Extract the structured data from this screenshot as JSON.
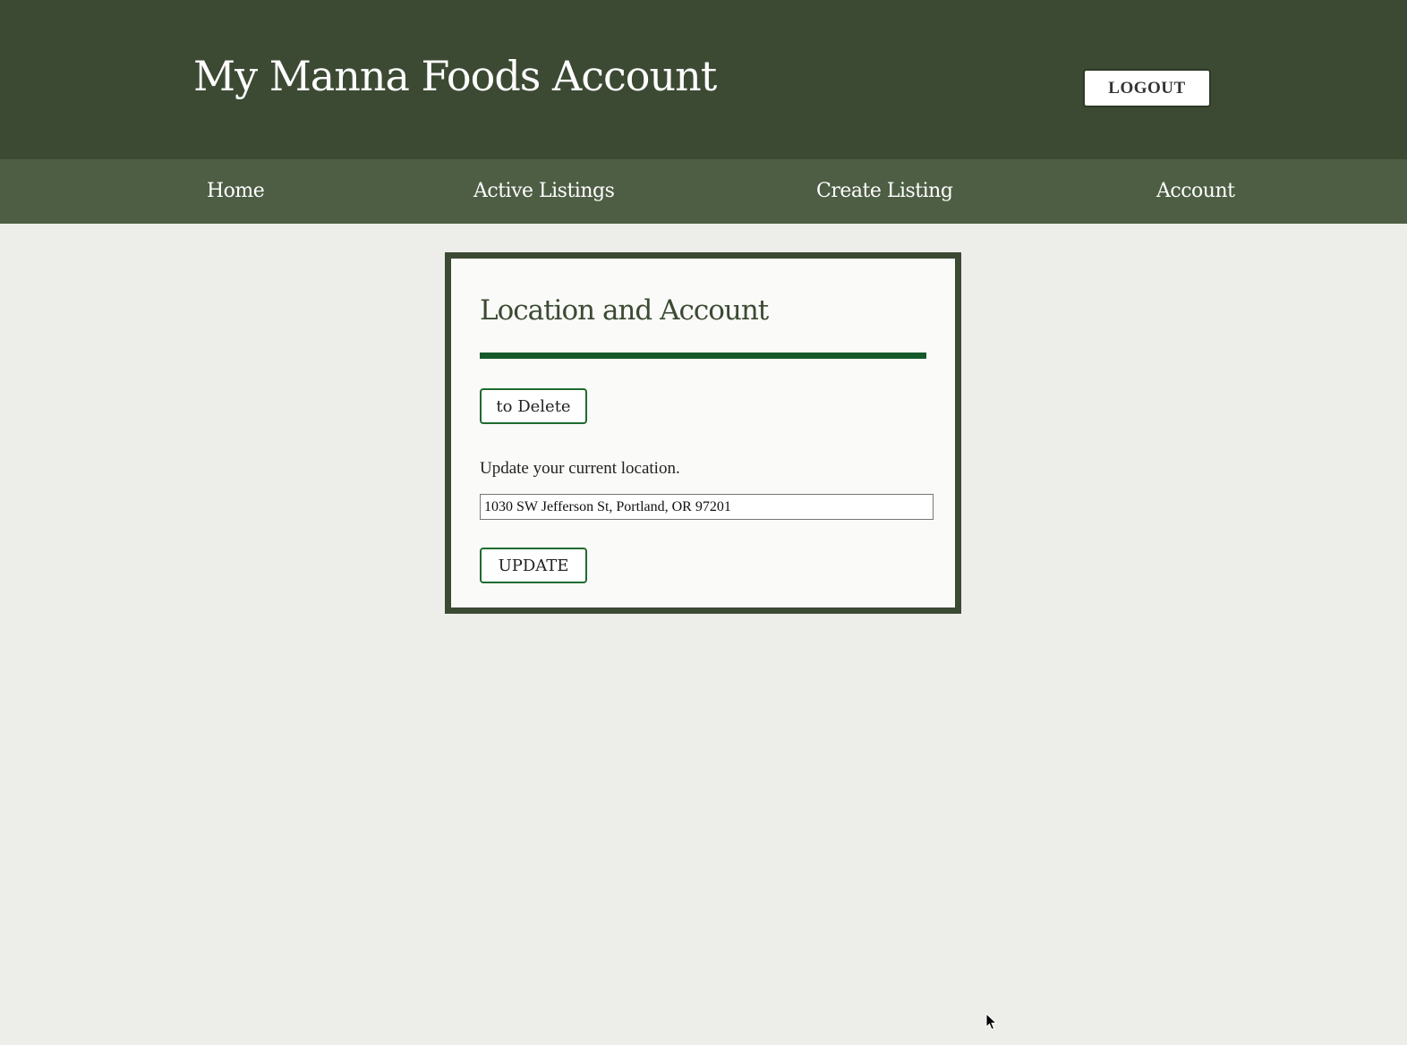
{
  "header": {
    "title": "My Manna Foods Account",
    "logout_label": "LOGOUT"
  },
  "nav": {
    "items": [
      {
        "label": "Home"
      },
      {
        "label": "Active Listings"
      },
      {
        "label": "Create Listing"
      },
      {
        "label": "Account"
      }
    ]
  },
  "account_card": {
    "title": "Location and Account",
    "delete_label": "to Delete",
    "location_prompt": "Update your current location.",
    "location_value": "1030 SW Jefferson St, Portland, OR 97201",
    "update_label": "UPDATE"
  },
  "colors": {
    "header_bg": "#3c4a33",
    "nav_bg": "#4e5e44",
    "page_bg": "#ededea",
    "accent_green": "#155a2a"
  }
}
